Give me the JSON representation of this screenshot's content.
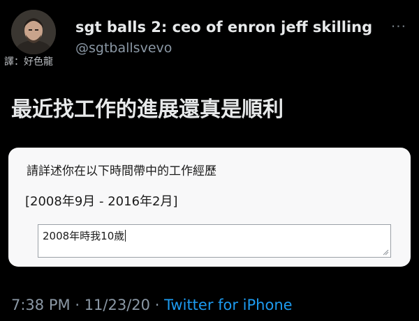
{
  "tweet": {
    "translator_note": "譯：好色龍",
    "author": {
      "display_name": "sgt balls 2: ceo of enron jeff skilling",
      "handle": "@sgtballsvevo",
      "avatar_icon": "profile-photo"
    },
    "more_icon": "more-dots-icon",
    "text": "最近找工作的進展還真是順利",
    "meta": {
      "time": "7:38 PM",
      "separator": "·",
      "date": "11/23/20",
      "source": "Twitter for iPhone"
    }
  },
  "form_screenshot": {
    "question": "請詳述你在以下時間帶中的工作經歷",
    "date_range": "[2008年9月 - 2016年2月]",
    "answer_value": "2008年時我10歲"
  },
  "colors": {
    "background": "#000000",
    "primary_text": "#e7e9ea",
    "secondary_text": "#8b98a5",
    "link": "#1d9bf0",
    "card": "#f8f8f9"
  }
}
